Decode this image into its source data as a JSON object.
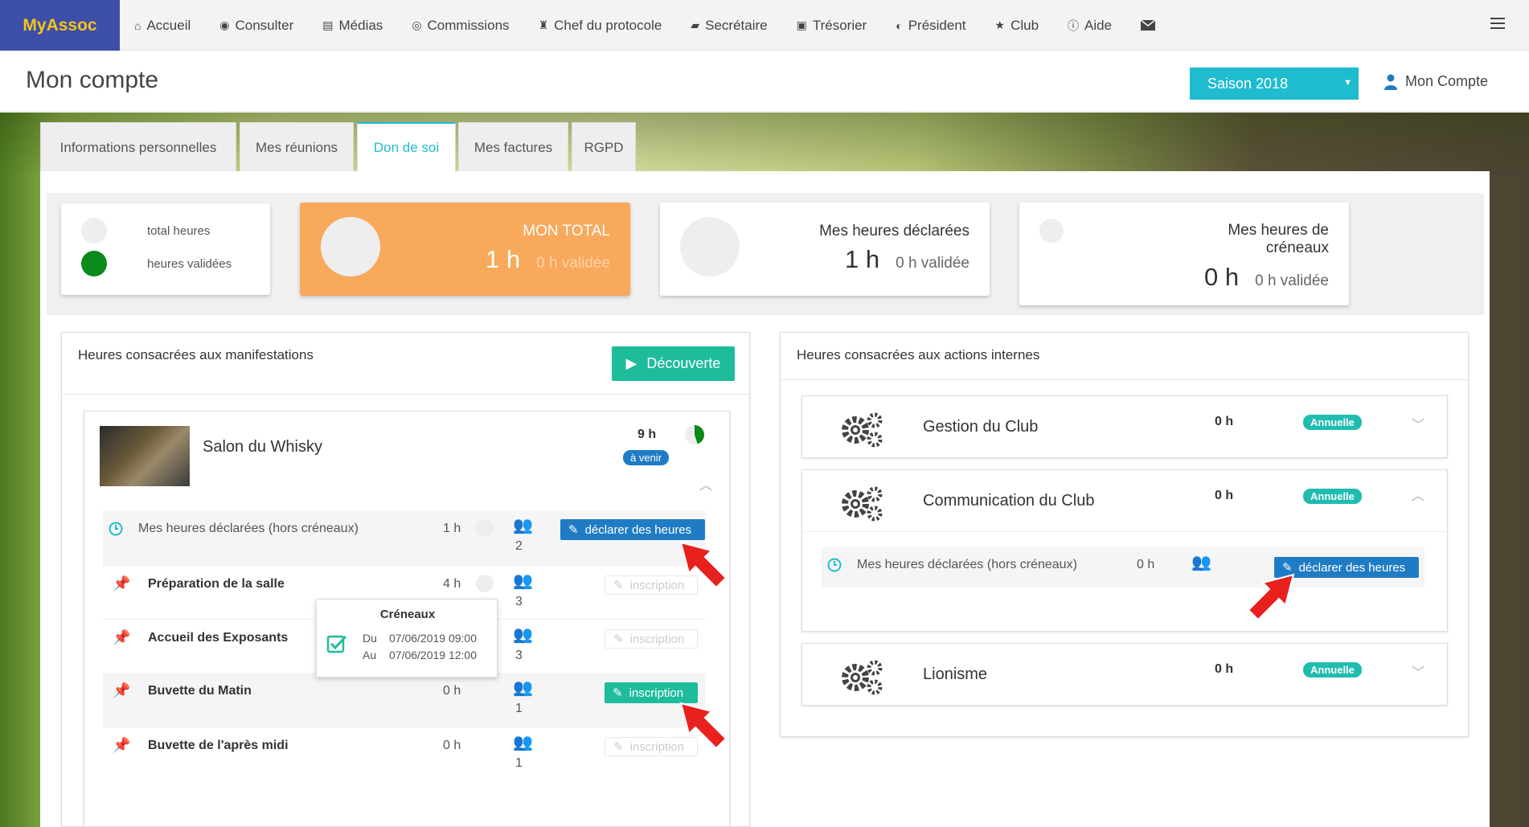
{
  "brand": "MyAssoc",
  "nav": {
    "items": [
      {
        "icon": "home-icon",
        "glyph": "⌂",
        "label": "Accueil"
      },
      {
        "icon": "eye-icon",
        "glyph": "◉",
        "label": "Consulter"
      },
      {
        "icon": "file-icon",
        "glyph": "▤",
        "label": "Médias"
      },
      {
        "icon": "commissions-icon",
        "glyph": "◎",
        "label": "Commissions"
      },
      {
        "icon": "trophy-icon",
        "glyph": "♜",
        "label": "Chef du protocole"
      },
      {
        "icon": "book-icon",
        "glyph": "▰",
        "label": "Secrétaire"
      },
      {
        "icon": "money-icon",
        "glyph": "▣",
        "label": "Trésorier"
      },
      {
        "icon": "globe-icon",
        "glyph": "◐",
        "label": "Président"
      },
      {
        "icon": "star-icon",
        "glyph": "★",
        "label": "Club"
      },
      {
        "icon": "info-icon",
        "glyph": "ⓘ",
        "label": "Aide"
      }
    ]
  },
  "header": {
    "title": "Mon compte",
    "season": "Saison 2018",
    "account": "Mon Compte"
  },
  "tabs": [
    "Informations personnelles",
    "Mes réunions",
    "Don de soi",
    "Mes factures",
    "RGPD"
  ],
  "legend": {
    "total": "total heures",
    "validated": "heures validées"
  },
  "stats": {
    "mon_total": {
      "title": "MON TOTAL",
      "value": "1 h",
      "validated": "0 h validée"
    },
    "declared": {
      "title": "Mes heures déclarées",
      "value": "1 h",
      "validated": "0 h validée"
    },
    "slots": {
      "title": "Mes heures de créneaux",
      "value": "0 h",
      "validated": "0 h validée"
    }
  },
  "events": {
    "title": "Heures consacrées aux manifestations",
    "discover": "Découverte",
    "event": {
      "name": "Salon du Whisky",
      "hours": "9 h",
      "status": "à venir",
      "progress": 0.45
    },
    "rows": [
      {
        "label": "Mes heures déclarées (hors créneaux)",
        "hours": "1 h",
        "count": "2",
        "action": "déclarer des heures"
      },
      {
        "label": "Préparation de la salle",
        "hours": "4 h",
        "count": "3",
        "action": "inscription"
      },
      {
        "label": "Accueil des Exposants",
        "hours": "",
        "count": "3",
        "action": "inscription"
      },
      {
        "label": "Buvette du Matin",
        "hours": "0 h",
        "count": "1",
        "action": "inscription"
      },
      {
        "label": "Buvette de l'après midi",
        "hours": "0 h",
        "count": "1",
        "action": "inscription"
      }
    ],
    "tooltip": {
      "title": "Créneaux",
      "from_label": "Du",
      "from": "07/06/2019 09:00",
      "to_label": "Au",
      "to": "07/06/2019 12:00"
    }
  },
  "internal": {
    "title": "Heures consacrées aux actions internes",
    "items": [
      {
        "name": "Gestion du Club",
        "hours": "0 h",
        "badge": "Annuelle"
      },
      {
        "name": "Communication du Club",
        "hours": "0 h",
        "badge": "Annuelle"
      },
      {
        "name": "Lionisme",
        "hours": "0 h",
        "badge": "Annuelle"
      }
    ],
    "sub_row": {
      "label": "Mes heures déclarées (hors créneaux)",
      "hours": "0 h",
      "action": "déclarer des heures"
    }
  }
}
